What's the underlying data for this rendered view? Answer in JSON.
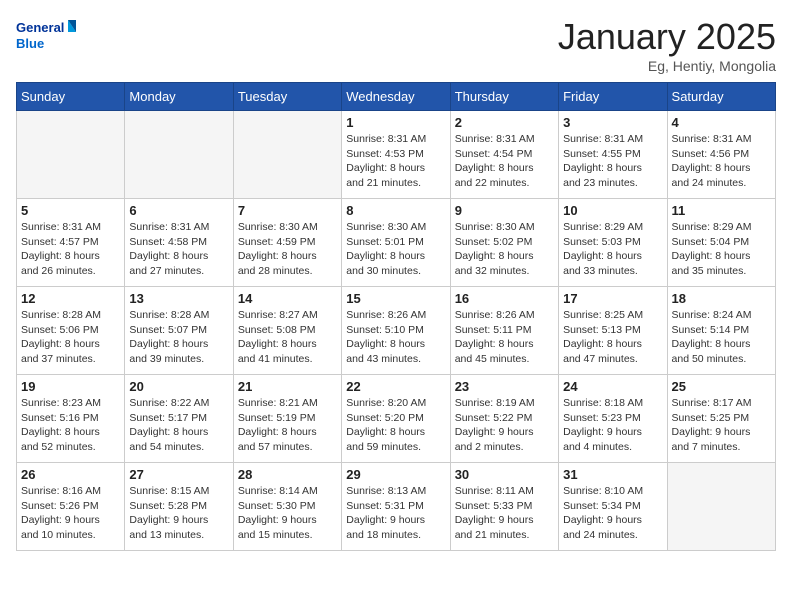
{
  "header": {
    "logo_line1": "General",
    "logo_line2": "Blue",
    "month": "January 2025",
    "location": "Eg, Hentiy, Mongolia"
  },
  "weekdays": [
    "Sunday",
    "Monday",
    "Tuesday",
    "Wednesday",
    "Thursday",
    "Friday",
    "Saturday"
  ],
  "weeks": [
    [
      {
        "day": "",
        "info": ""
      },
      {
        "day": "",
        "info": ""
      },
      {
        "day": "",
        "info": ""
      },
      {
        "day": "1",
        "info": "Sunrise: 8:31 AM\nSunset: 4:53 PM\nDaylight: 8 hours\nand 21 minutes."
      },
      {
        "day": "2",
        "info": "Sunrise: 8:31 AM\nSunset: 4:54 PM\nDaylight: 8 hours\nand 22 minutes."
      },
      {
        "day": "3",
        "info": "Sunrise: 8:31 AM\nSunset: 4:55 PM\nDaylight: 8 hours\nand 23 minutes."
      },
      {
        "day": "4",
        "info": "Sunrise: 8:31 AM\nSunset: 4:56 PM\nDaylight: 8 hours\nand 24 minutes."
      }
    ],
    [
      {
        "day": "5",
        "info": "Sunrise: 8:31 AM\nSunset: 4:57 PM\nDaylight: 8 hours\nand 26 minutes."
      },
      {
        "day": "6",
        "info": "Sunrise: 8:31 AM\nSunset: 4:58 PM\nDaylight: 8 hours\nand 27 minutes."
      },
      {
        "day": "7",
        "info": "Sunrise: 8:30 AM\nSunset: 4:59 PM\nDaylight: 8 hours\nand 28 minutes."
      },
      {
        "day": "8",
        "info": "Sunrise: 8:30 AM\nSunset: 5:01 PM\nDaylight: 8 hours\nand 30 minutes."
      },
      {
        "day": "9",
        "info": "Sunrise: 8:30 AM\nSunset: 5:02 PM\nDaylight: 8 hours\nand 32 minutes."
      },
      {
        "day": "10",
        "info": "Sunrise: 8:29 AM\nSunset: 5:03 PM\nDaylight: 8 hours\nand 33 minutes."
      },
      {
        "day": "11",
        "info": "Sunrise: 8:29 AM\nSunset: 5:04 PM\nDaylight: 8 hours\nand 35 minutes."
      }
    ],
    [
      {
        "day": "12",
        "info": "Sunrise: 8:28 AM\nSunset: 5:06 PM\nDaylight: 8 hours\nand 37 minutes."
      },
      {
        "day": "13",
        "info": "Sunrise: 8:28 AM\nSunset: 5:07 PM\nDaylight: 8 hours\nand 39 minutes."
      },
      {
        "day": "14",
        "info": "Sunrise: 8:27 AM\nSunset: 5:08 PM\nDaylight: 8 hours\nand 41 minutes."
      },
      {
        "day": "15",
        "info": "Sunrise: 8:26 AM\nSunset: 5:10 PM\nDaylight: 8 hours\nand 43 minutes."
      },
      {
        "day": "16",
        "info": "Sunrise: 8:26 AM\nSunset: 5:11 PM\nDaylight: 8 hours\nand 45 minutes."
      },
      {
        "day": "17",
        "info": "Sunrise: 8:25 AM\nSunset: 5:13 PM\nDaylight: 8 hours\nand 47 minutes."
      },
      {
        "day": "18",
        "info": "Sunrise: 8:24 AM\nSunset: 5:14 PM\nDaylight: 8 hours\nand 50 minutes."
      }
    ],
    [
      {
        "day": "19",
        "info": "Sunrise: 8:23 AM\nSunset: 5:16 PM\nDaylight: 8 hours\nand 52 minutes."
      },
      {
        "day": "20",
        "info": "Sunrise: 8:22 AM\nSunset: 5:17 PM\nDaylight: 8 hours\nand 54 minutes."
      },
      {
        "day": "21",
        "info": "Sunrise: 8:21 AM\nSunset: 5:19 PM\nDaylight: 8 hours\nand 57 minutes."
      },
      {
        "day": "22",
        "info": "Sunrise: 8:20 AM\nSunset: 5:20 PM\nDaylight: 8 hours\nand 59 minutes."
      },
      {
        "day": "23",
        "info": "Sunrise: 8:19 AM\nSunset: 5:22 PM\nDaylight: 9 hours\nand 2 minutes."
      },
      {
        "day": "24",
        "info": "Sunrise: 8:18 AM\nSunset: 5:23 PM\nDaylight: 9 hours\nand 4 minutes."
      },
      {
        "day": "25",
        "info": "Sunrise: 8:17 AM\nSunset: 5:25 PM\nDaylight: 9 hours\nand 7 minutes."
      }
    ],
    [
      {
        "day": "26",
        "info": "Sunrise: 8:16 AM\nSunset: 5:26 PM\nDaylight: 9 hours\nand 10 minutes."
      },
      {
        "day": "27",
        "info": "Sunrise: 8:15 AM\nSunset: 5:28 PM\nDaylight: 9 hours\nand 13 minutes."
      },
      {
        "day": "28",
        "info": "Sunrise: 8:14 AM\nSunset: 5:30 PM\nDaylight: 9 hours\nand 15 minutes."
      },
      {
        "day": "29",
        "info": "Sunrise: 8:13 AM\nSunset: 5:31 PM\nDaylight: 9 hours\nand 18 minutes."
      },
      {
        "day": "30",
        "info": "Sunrise: 8:11 AM\nSunset: 5:33 PM\nDaylight: 9 hours\nand 21 minutes."
      },
      {
        "day": "31",
        "info": "Sunrise: 8:10 AM\nSunset: 5:34 PM\nDaylight: 9 hours\nand 24 minutes."
      },
      {
        "day": "",
        "info": ""
      }
    ]
  ]
}
